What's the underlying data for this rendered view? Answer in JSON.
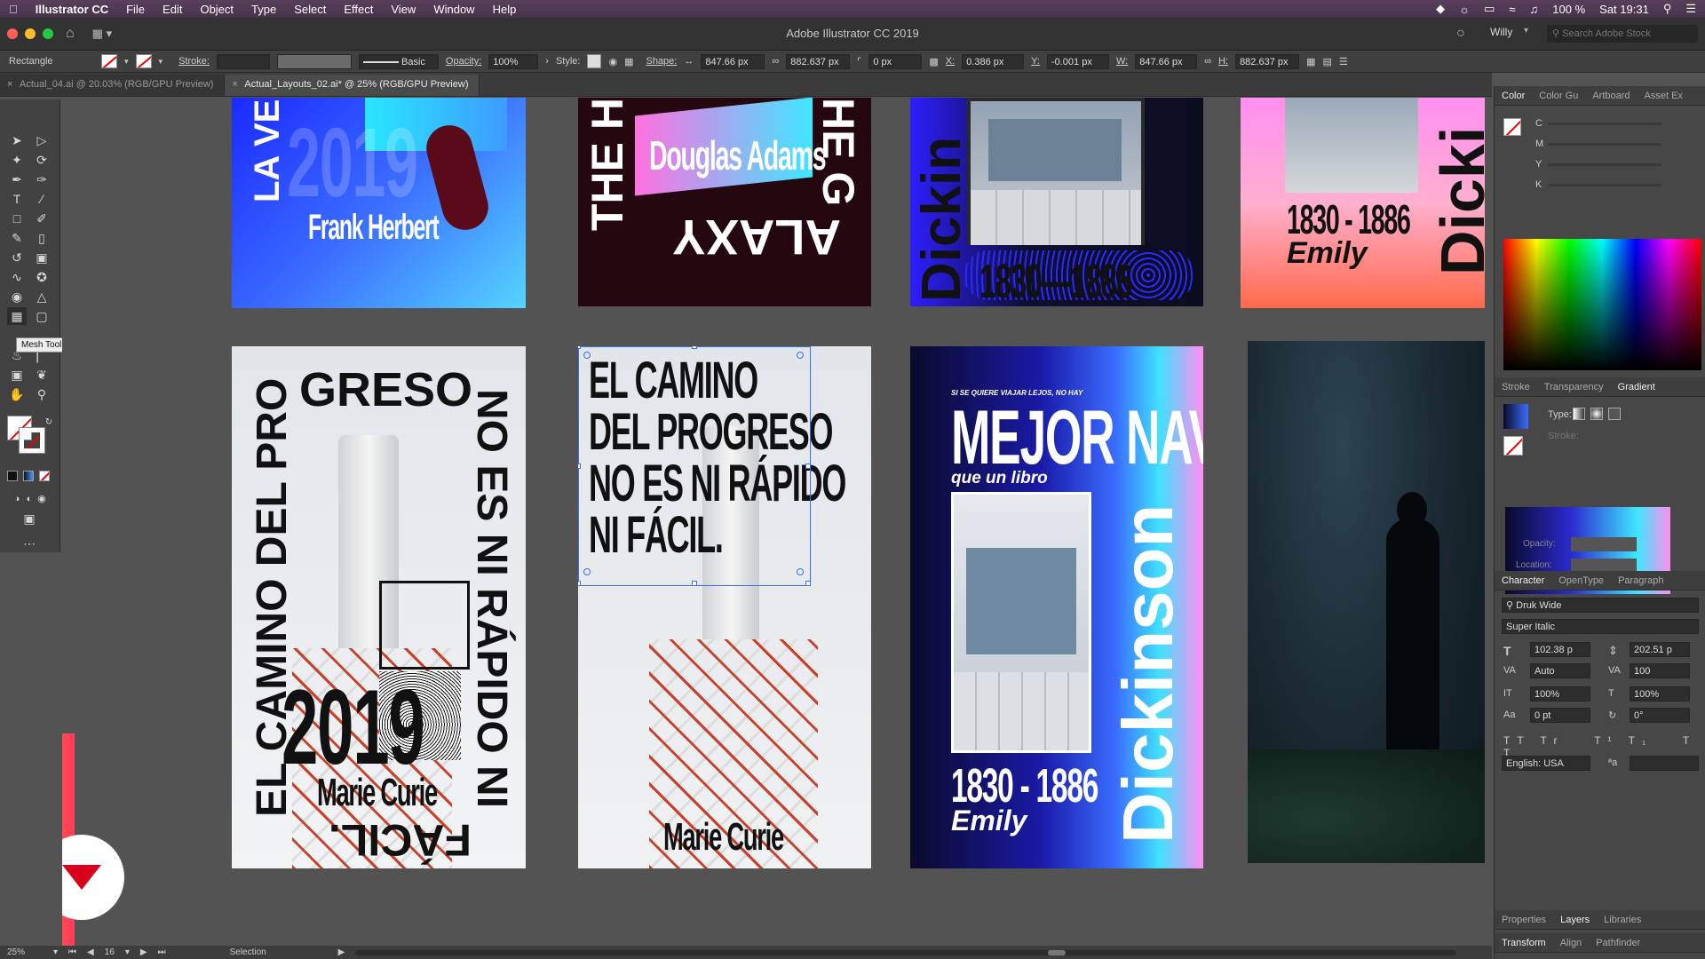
{
  "menubar": {
    "app_name": "Illustrator CC",
    "items": [
      "File",
      "Edit",
      "Object",
      "Type",
      "Select",
      "Effect",
      "View",
      "Window",
      "Help"
    ],
    "battery": "100 %",
    "clock": "Sat 19:31"
  },
  "window": {
    "title": "Adobe Illustrator CC 2019",
    "user": "Willy",
    "search_placeholder": "Search Adobe Stock"
  },
  "control": {
    "object_type": "Rectangle",
    "stroke_label": "Stroke:",
    "stroke_style": "Basic",
    "opacity_label": "Opacity:",
    "opacity_value": "100%",
    "style_label": "Style:",
    "shape_label": "Shape:",
    "shape_w": "847.66 px",
    "shape_h": "882.637 px",
    "corner": "0 px",
    "x_label": "X:",
    "x_value": "0.386 px",
    "y_label": "Y:",
    "y_value": "-0.001 px",
    "w_label": "W:",
    "w_value": "847.66 px",
    "h_label": "H:",
    "h_value": "882.637 px"
  },
  "tabs": [
    {
      "label": "Actual_04.ai @ 20.03% (RGB/GPU Preview)",
      "active": false
    },
    {
      "label": "Actual_Layouts_02.ai* @ 25% (RGB/GPU Preview)",
      "active": true
    }
  ],
  "tooltip": "Mesh Tool (U)",
  "posters": {
    "p1_year": "2019",
    "p1_side": "LA VE",
    "p1_author": "Frank Herbert",
    "p2_author": "Douglas Adams",
    "p2_left": "THE H",
    "p2_right": "HE G",
    "p2_bottom": "ALAXY",
    "p3_years": "1830—1886",
    "p3_name": "Dickin",
    "p4_years": "1830 - 1886",
    "p4_first": "Emily",
    "p4_last": "Dicki",
    "p5_top": "GRESO",
    "p5_left": "EL CAMINO DEL PRO",
    "p5_right": "NO ES NI RÁPIDO NI",
    "p5_bottom": "FÁCIL.",
    "p5_year": "2019",
    "p5_author": "Marie Curie",
    "p6_line1": "EL CAMINO",
    "p6_line2": "DEL PROGRESO",
    "p6_line3": "NO ES NI RÁPIDO",
    "p6_line4": "NI FÁCIL.",
    "p6_author": "Marie Curie",
    "p7_kicker": "SI SE QUIERE VIAJAR LEJOS, NO HAY",
    "p7_title": "MEJOR NAVE",
    "p7_sub": "que un libro",
    "p7_years": "1830 - 1886",
    "p7_first": "Emily",
    "p7_last": "Dickinson"
  },
  "panels": {
    "color_tabs": [
      "Color",
      "Color Gu",
      "Artboard",
      "Asset Ex"
    ],
    "cmyk": [
      "C",
      "M",
      "Y",
      "K"
    ],
    "mid_tabs": [
      "Stroke",
      "Transparency",
      "Gradient"
    ],
    "type_label": "Type:",
    "stroke_label": "Stroke:",
    "opacity_label": "Opacity:",
    "location_label": "Location:",
    "char_tabs": [
      "Character",
      "OpenType",
      "Paragraph"
    ],
    "font": "Druk Wide",
    "style": "Super Italic",
    "size": "102.38 p",
    "leading": "202.51 p",
    "kerning": "Auto",
    "tracking": "100",
    "vscale": "100%",
    "hscale": "100%",
    "baseline": "0 pt",
    "rotation": "0°",
    "language": "English: USA",
    "bottom_tabs": [
      "Properties",
      "Layers",
      "Libraries"
    ],
    "bottom_tabs2": [
      "Transform",
      "Align",
      "Pathfinder"
    ]
  },
  "status": {
    "zoom": "25%",
    "artboard": "16",
    "tool": "Selection"
  },
  "colors": {
    "accent_blue": "#2f4cff",
    "accent_pink": "#ff7fd0",
    "accent_cyan": "#3fe6ff",
    "dark": "#0b0b1e",
    "logo_red": "#d8001c"
  }
}
